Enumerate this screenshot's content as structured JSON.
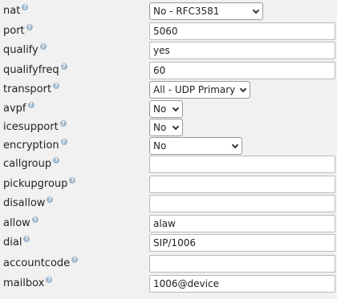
{
  "fields": [
    {
      "label": "nat",
      "type": "select",
      "value": "No - RFC3581"
    },
    {
      "label": "port",
      "type": "text",
      "value": "5060"
    },
    {
      "label": "qualify",
      "type": "text",
      "value": "yes"
    },
    {
      "label": "qualifyfreq",
      "type": "text",
      "value": "60"
    },
    {
      "label": "transport",
      "type": "select",
      "value": "All - UDP Primary"
    },
    {
      "label": "avpf",
      "type": "select",
      "value": "No"
    },
    {
      "label": "icesupport",
      "type": "select",
      "value": "No"
    },
    {
      "label": "encryption",
      "type": "select",
      "value": "No"
    },
    {
      "label": "callgroup",
      "type": "text",
      "value": ""
    },
    {
      "label": "pickupgroup",
      "type": "text",
      "value": ""
    },
    {
      "label": "disallow",
      "type": "text",
      "value": ""
    },
    {
      "label": "allow",
      "type": "text",
      "value": "alaw"
    },
    {
      "label": "dial",
      "type": "text",
      "value": "SIP/1006"
    },
    {
      "label": "accountcode",
      "type": "text",
      "value": ""
    },
    {
      "label": "mailbox",
      "type": "text",
      "value": "1006@device"
    }
  ],
  "help_icon": {
    "name": "help-icon",
    "glyph": "?",
    "color": "#9fb6cb"
  }
}
